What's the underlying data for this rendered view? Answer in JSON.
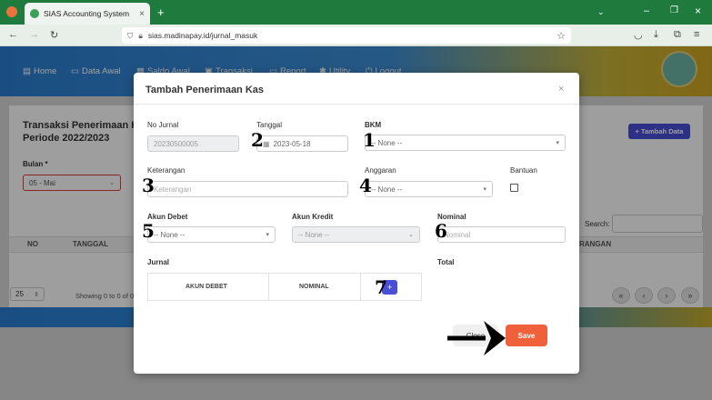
{
  "browser": {
    "tab_title": "SIAS Accounting System",
    "url": "sias.madinapay.id/jurnal_masuk"
  },
  "nav": {
    "items": [
      "Home",
      "Data Awal",
      "Saldo Awal",
      "Transaksi",
      "Report",
      "Utility",
      "Logout"
    ]
  },
  "page": {
    "title_line1": "Transaksi Penerimaan Ka",
    "title_line2": "Periode 2022/2023",
    "add_button": "Tambah Data",
    "bulan_label": "Bulan *",
    "bulan_value": "05 - Mai",
    "search_label": "Search:",
    "columns": [
      "NO",
      "TANGGAL",
      "RANGAN"
    ],
    "per_page": "25",
    "showing": "Showing 0 to 0 of 0"
  },
  "modal": {
    "title": "Tambah Penerimaan Kas",
    "close_glyph": "×",
    "no_jurnal_label": "No Jurnal",
    "no_jurnal_value": "20230500005",
    "tanggal_label": "Tanggal",
    "tanggal_value": "2023-05-18",
    "bkm_label": "BKM",
    "bkm_value": "-- None --",
    "keterangan_label": "Keterangan",
    "keterangan_placeholder": "Keterangan",
    "anggaran_label": "Anggaran",
    "anggaran_value": "-- None --",
    "bantuan_label": "Bantuan",
    "akun_debet_label": "Akun Debet",
    "akun_debet_value": "-- None --",
    "akun_kredit_label": "Akun Kredit",
    "akun_kredit_value": "-- None --",
    "nominal_label": "Nominal",
    "nominal_placeholder": "Nominal",
    "jurnal_label": "Jurnal",
    "total_label": "Total",
    "jurnal_columns": [
      "AKUN DEBET",
      "NOMINAL"
    ],
    "add_row_glyph": "+",
    "close_button": "Close",
    "save_button": "Save"
  },
  "annotations": [
    "1",
    "2",
    "3",
    "4",
    "5",
    "6",
    "7"
  ],
  "colors": {
    "accent": "#4a4fd8",
    "save": "#f0603a",
    "nav_start": "#2b7fd4",
    "nav_end": "#d1a722"
  }
}
